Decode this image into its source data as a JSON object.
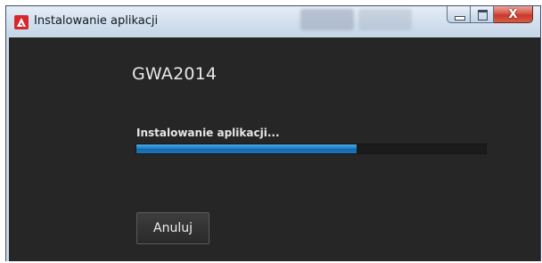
{
  "window": {
    "title": "Instalowanie aplikacji",
    "icon": "adobe-air-icon",
    "controls": {
      "minimize_icon": "minimize-icon",
      "maximize_icon": "maximize-icon",
      "close_label": "X"
    }
  },
  "installer": {
    "app_name": "GWA2014",
    "status": "Instalowanie aplikacji...",
    "progress": 0.63,
    "cancel_label": "Anuluj"
  },
  "colors": {
    "content_background": "#262626",
    "progress_fill": "#1f7fc4",
    "close_button": "#c7392c"
  }
}
